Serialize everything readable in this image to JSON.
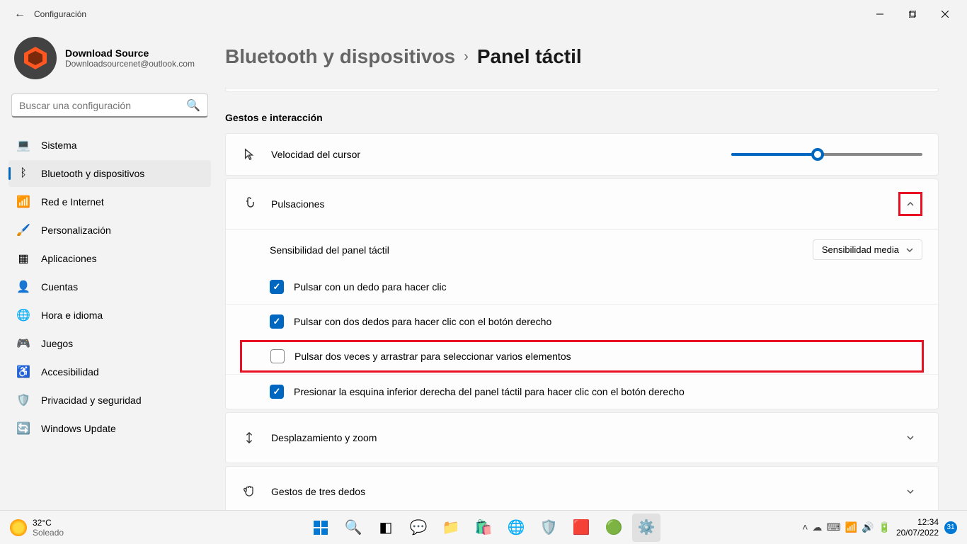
{
  "titlebar": {
    "title": "Configuración"
  },
  "profile": {
    "name": "Download Source",
    "email": "Downloadsourcenet@outlook.com"
  },
  "search": {
    "placeholder": "Buscar una configuración"
  },
  "nav": {
    "items": [
      {
        "icon": "💻",
        "label": "Sistema"
      },
      {
        "icon": "ᛒ",
        "label": "Bluetooth y dispositivos",
        "active": true
      },
      {
        "icon": "📶",
        "label": "Red e Internet"
      },
      {
        "icon": "🖌️",
        "label": "Personalización"
      },
      {
        "icon": "▦",
        "label": "Aplicaciones"
      },
      {
        "icon": "👤",
        "label": "Cuentas"
      },
      {
        "icon": "🌐",
        "label": "Hora e idioma"
      },
      {
        "icon": "🎮",
        "label": "Juegos"
      },
      {
        "icon": "♿",
        "label": "Accesibilidad"
      },
      {
        "icon": "🛡️",
        "label": "Privacidad y seguridad"
      },
      {
        "icon": "🔄",
        "label": "Windows Update"
      }
    ]
  },
  "breadcrumb": {
    "seg1": "Bluetooth y dispositivos",
    "seg2": "Panel táctil"
  },
  "section": {
    "gestures": "Gestos e interacción"
  },
  "cards": {
    "cursor_speed": {
      "label": "Velocidad del cursor",
      "slider_pct": 45
    },
    "taps": {
      "label": "Pulsaciones",
      "sensitivity_label": "Sensibilidad del panel táctil",
      "sensitivity_value": "Sensibilidad media",
      "options": [
        {
          "checked": true,
          "label": "Pulsar con un dedo para hacer clic"
        },
        {
          "checked": true,
          "label": "Pulsar con dos dedos para hacer clic con el botón derecho"
        },
        {
          "checked": false,
          "label": "Pulsar dos veces y arrastrar para seleccionar varios elementos",
          "highlight": true
        },
        {
          "checked": true,
          "label": "Presionar la esquina inferior derecha del panel táctil para hacer clic con el botón derecho"
        }
      ]
    },
    "scroll": {
      "label": "Desplazamiento y zoom"
    },
    "three_finger": {
      "label": "Gestos de tres dedos"
    }
  },
  "taskbar": {
    "weather": {
      "temp": "32°C",
      "cond": "Soleado"
    },
    "time": "12:34",
    "date": "20/07/2022",
    "badge": "31"
  }
}
